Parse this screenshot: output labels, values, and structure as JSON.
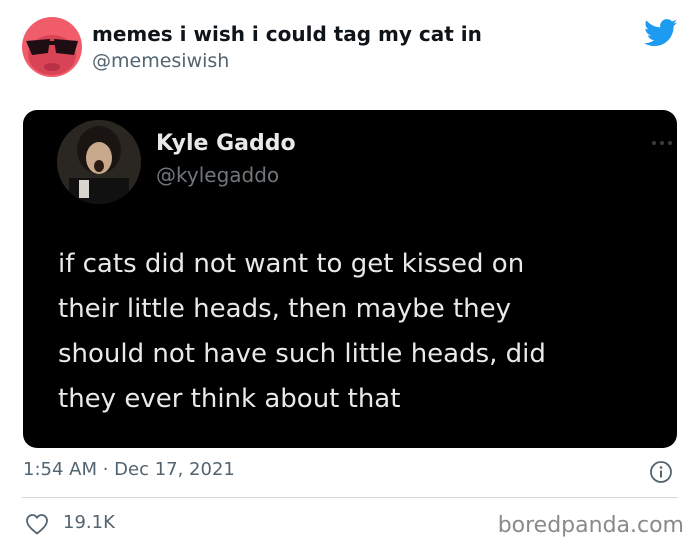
{
  "tweet": {
    "author": {
      "display_name": "memes i wish i could tag my cat in",
      "handle": "@memesiwish",
      "avatar_icon": "red-cat-sunglasses-avatar"
    },
    "brand_icon": "twitter-bird-icon",
    "brand_color": "#1d9bf0",
    "embedded_tweet": {
      "display_name": "Kyle Gaddo",
      "handle": "@kylegaddo",
      "text_lines": [
        "if cats did not want to get kissed on",
        "their little heads, then maybe they",
        "should not have such little heads, did",
        "they ever think about that"
      ],
      "more_icon": "more-options-icon"
    },
    "timestamp": "1:54 AM · Dec 17, 2021",
    "info_icon": "info-icon",
    "likes": "19.1K",
    "like_icon": "heart-icon"
  },
  "watermark": "boredpanda.com"
}
